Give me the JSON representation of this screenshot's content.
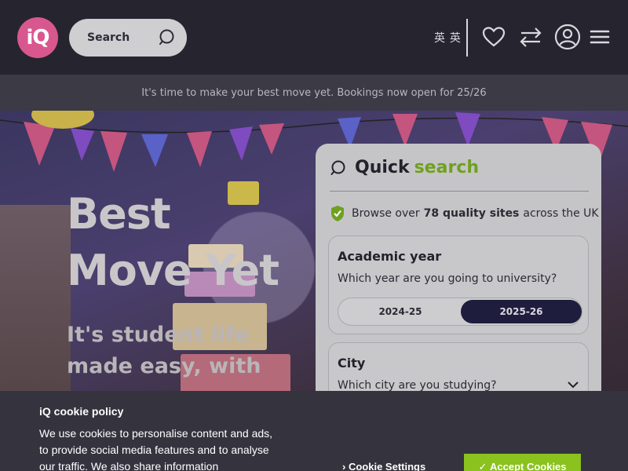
{
  "header": {
    "logo_text": "iQ",
    "search_label": "Search",
    "language": "英 英",
    "icons": [
      "heart-icon",
      "compare-arrows-icon",
      "account-icon",
      "menu-icon"
    ]
  },
  "banner": {
    "text": "It's time to make your best move yet. Bookings now open for 25/26"
  },
  "hero": {
    "title": "Best Move Yet",
    "subtitle": "It's student life made easy, with"
  },
  "quick_search": {
    "title_part1": "Quick",
    "title_part2": "search",
    "browse_pre": "Browse over",
    "browse_bold": "78 quality sites",
    "browse_post": "across the UK",
    "academic_year": {
      "title": "Academic year",
      "question": "Which year are you going to university?",
      "options": [
        "2024-25",
        "2025-26"
      ],
      "selected": "2025-26"
    },
    "city": {
      "title": "City",
      "question": "Which city are you studying?"
    }
  },
  "cookie": {
    "title": "iQ cookie policy",
    "text": "We use cookies to personalise content and ads, to provide social media features and to analyse our traffic. We also share information",
    "settings_label": "Cookie Settings",
    "accept_label": "Accept Cookies"
  },
  "colors": {
    "brand_pink": "#d9578f",
    "accent_green": "#6fa020",
    "accept_green": "#8bc21d",
    "navy": "#1f1d3d"
  }
}
